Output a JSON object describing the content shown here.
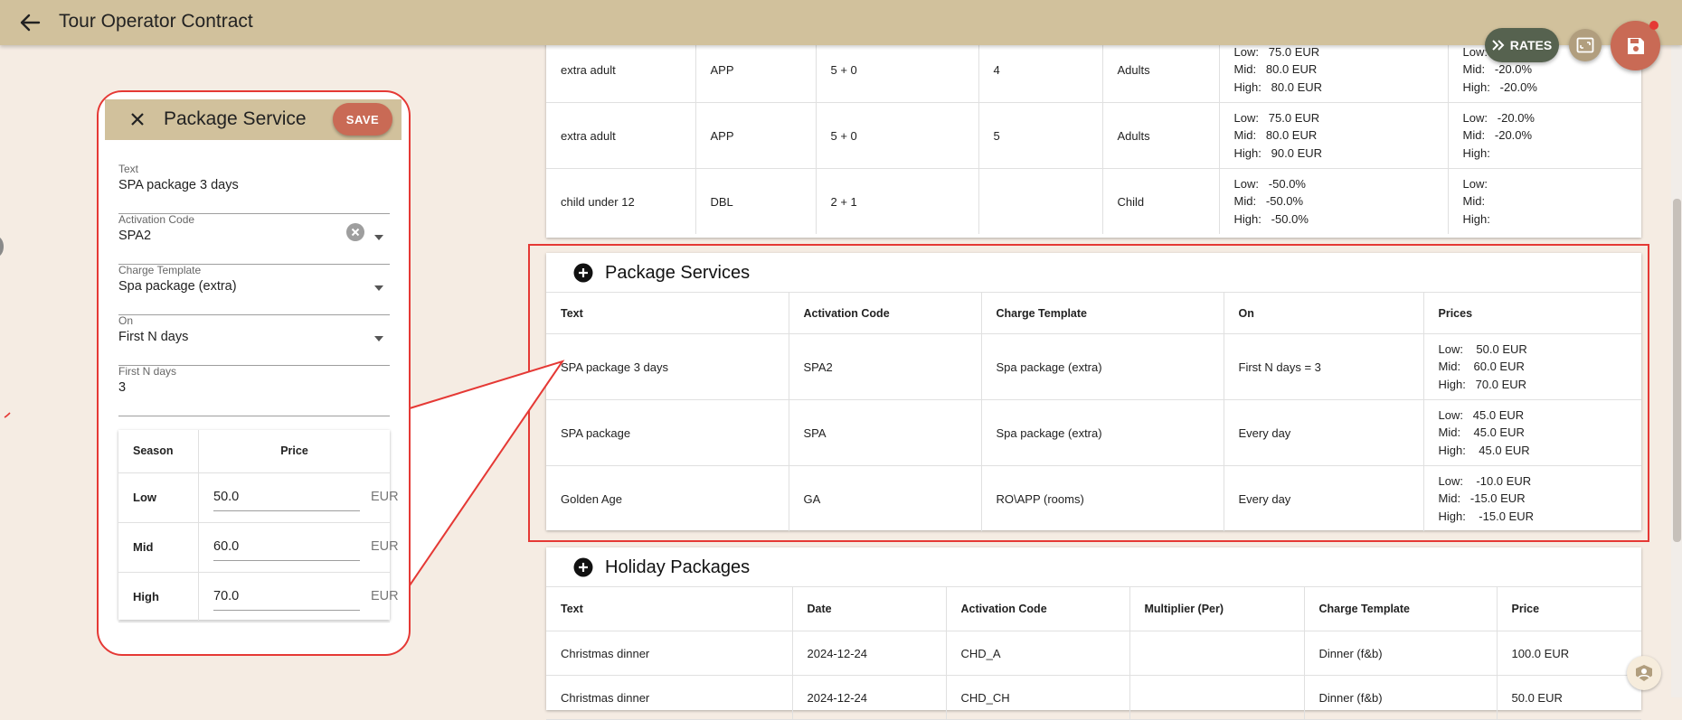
{
  "app": {
    "title": "Tour Operator Contract"
  },
  "actions": {
    "rates_label": "RATES"
  },
  "rates_rows": [
    {
      "text": "extra adult",
      "room": "APP",
      "occupancy": "5 + 0",
      "count": "4",
      "type": "Adults",
      "prices": [
        "Low:   75.0 EUR",
        "Mid:   80.0 EUR",
        "High:   80.0 EUR"
      ],
      "discounts": [
        "Low:   -20.0%",
        "Mid:   -20.0%",
        "High:   -20.0%"
      ]
    },
    {
      "text": "extra adult",
      "room": "APP",
      "occupancy": "5 + 0",
      "count": "5",
      "type": "Adults",
      "prices": [
        "Low:   75.0 EUR",
        "Mid:   80.0 EUR",
        "High:   90.0 EUR"
      ],
      "discounts": [
        "Low:   -20.0%",
        "Mid:   -20.0%",
        "High:"
      ]
    },
    {
      "text": "child under 12",
      "room": "DBL",
      "occupancy": "2 + 1",
      "count": "",
      "type": "Child",
      "prices": [
        "Low:   -50.0%",
        "Mid:   -50.0%",
        "High:   -50.0%"
      ],
      "discounts": [
        "Low:",
        "Mid:",
        "High:"
      ]
    }
  ],
  "package_services": {
    "title": "Package Services",
    "columns": [
      "Text",
      "Activation Code",
      "Charge Template",
      "On",
      "Prices"
    ],
    "rows": [
      {
        "text": "SPA package 3 days",
        "code": "SPA2",
        "template": "Spa package (extra)",
        "on": "First N days = 3",
        "prices": [
          "Low:    50.0 EUR",
          "Mid:    60.0 EUR",
          "High:   70.0 EUR"
        ]
      },
      {
        "text": "SPA package",
        "code": "SPA",
        "template": "Spa package (extra)",
        "on": "Every day",
        "prices": [
          "Low:   45.0 EUR",
          "Mid:    45.0 EUR",
          "High:    45.0 EUR"
        ]
      },
      {
        "text": "Golden Age",
        "code": "GA",
        "template": "RO\\APP (rooms)",
        "on": "Every day",
        "prices": [
          "Low:    -10.0 EUR",
          "Mid:   -15.0 EUR",
          "High:    -15.0 EUR"
        ]
      }
    ]
  },
  "holiday_packages": {
    "title": "Holiday Packages",
    "columns": [
      "Text",
      "Date",
      "Activation Code",
      "Multiplier (Per)",
      "Charge Template",
      "Price"
    ],
    "rows": [
      {
        "text": "Christmas dinner",
        "date": "2024-12-24",
        "code": "CHD_A",
        "multiplier": "",
        "template": "Dinner (f&b)",
        "price": "100.0 EUR"
      },
      {
        "text": "Christmas dinner",
        "date": "2024-12-24",
        "code": "CHD_CH",
        "multiplier": "",
        "template": "Dinner (f&b)",
        "price": "50.0 EUR"
      }
    ]
  },
  "dialog": {
    "title": "Package Service",
    "save_label": "SAVE",
    "fields": {
      "text": {
        "label": "Text",
        "value": "SPA package 3 days"
      },
      "activation_code": {
        "label": "Activation Code",
        "value": "SPA2"
      },
      "charge_template": {
        "label": "Charge Template",
        "value": "Spa package (extra)"
      },
      "on": {
        "label": "On",
        "value": "First N days"
      },
      "first_n_days": {
        "label": "First N days",
        "value": "3"
      }
    },
    "price_table": {
      "season_header": "Season",
      "price_header": "Price",
      "currency": "EUR",
      "rows": [
        {
          "season": "Low",
          "price": "50.0"
        },
        {
          "season": "Mid",
          "price": "60.0"
        },
        {
          "season": "High",
          "price": "70.0"
        }
      ]
    }
  },
  "colors": {
    "topbar": "#d1c19c",
    "accent": "#c96a55",
    "rates_pill": "#56624f",
    "highlight": "#e53935",
    "background": "#f5ece3"
  }
}
